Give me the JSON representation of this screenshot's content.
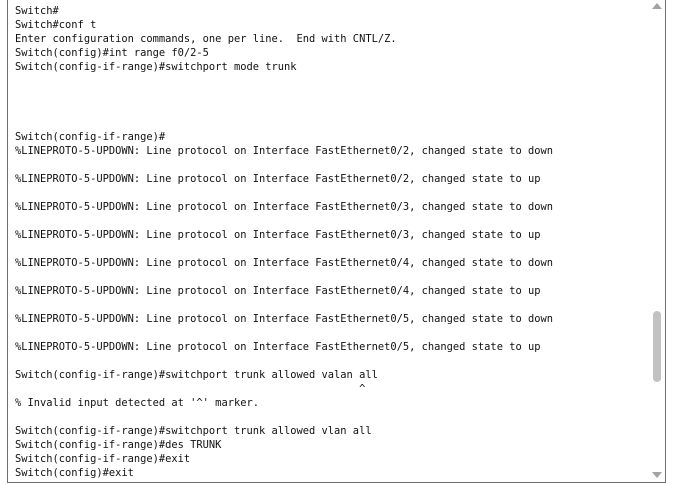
{
  "terminal": {
    "lines": [
      "Switch#",
      "Switch#conf t",
      "Enter configuration commands, one per line.  End with CNTL/Z.",
      "Switch(config)#int range f0/2-5",
      "Switch(config-if-range)#switchport mode trunk",
      "",
      "",
      "",
      "",
      "Switch(config-if-range)#",
      "%LINEPROTO-5-UPDOWN: Line protocol on Interface FastEthernet0/2, changed state to down",
      "",
      "%LINEPROTO-5-UPDOWN: Line protocol on Interface FastEthernet0/2, changed state to up",
      "",
      "%LINEPROTO-5-UPDOWN: Line protocol on Interface FastEthernet0/3, changed state to down",
      "",
      "%LINEPROTO-5-UPDOWN: Line protocol on Interface FastEthernet0/3, changed state to up",
      "",
      "%LINEPROTO-5-UPDOWN: Line protocol on Interface FastEthernet0/4, changed state to down",
      "",
      "%LINEPROTO-5-UPDOWN: Line protocol on Interface FastEthernet0/4, changed state to up",
      "",
      "%LINEPROTO-5-UPDOWN: Line protocol on Interface FastEthernet0/5, changed state to down",
      "",
      "%LINEPROTO-5-UPDOWN: Line protocol on Interface FastEthernet0/5, changed state to up",
      "",
      "Switch(config-if-range)#switchport trunk allowed valan all",
      "                                                       ^",
      "% Invalid input detected at '^' marker.",
      "",
      "Switch(config-if-range)#switchport trunk allowed vlan all",
      "Switch(config-if-range)#des TRUNK",
      "Switch(config-if-range)#exit",
      "Switch(config)#exit"
    ]
  },
  "scrollbar": {
    "up_icon": "triangle-up-icon",
    "down_icon": "triangle-down-icon"
  }
}
